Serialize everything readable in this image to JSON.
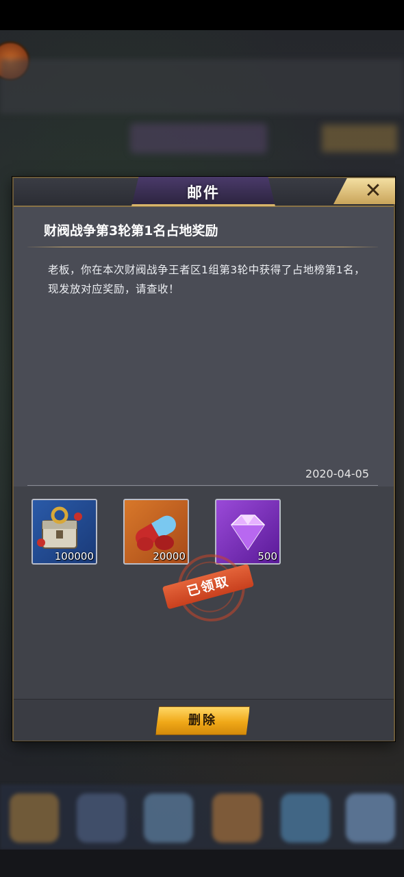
{
  "dialog": {
    "title": "邮件",
    "close_label": "✕"
  },
  "mail": {
    "subject": "财阀战争第3轮第1名占地奖励",
    "body": "老板，你在本次财阀战争王者区1组第3轮中获得了占地榜第1名，现发放对应奖励，请查收！",
    "date": "2020-04-05"
  },
  "rewards": [
    {
      "icon": "treasure-chest-icon",
      "count": "100000"
    },
    {
      "icon": "pill-capsule-icon",
      "count": "20000"
    },
    {
      "icon": "purple-diamond-icon",
      "count": "500"
    }
  ],
  "status": {
    "claimed_label": "已领取"
  },
  "footer": {
    "delete_label": "删除"
  },
  "colors": {
    "panel": "#4a4c55",
    "gold_accent": "#c8aa6e",
    "button_gold": "#f0a818",
    "stamp_red": "#c8401e"
  }
}
